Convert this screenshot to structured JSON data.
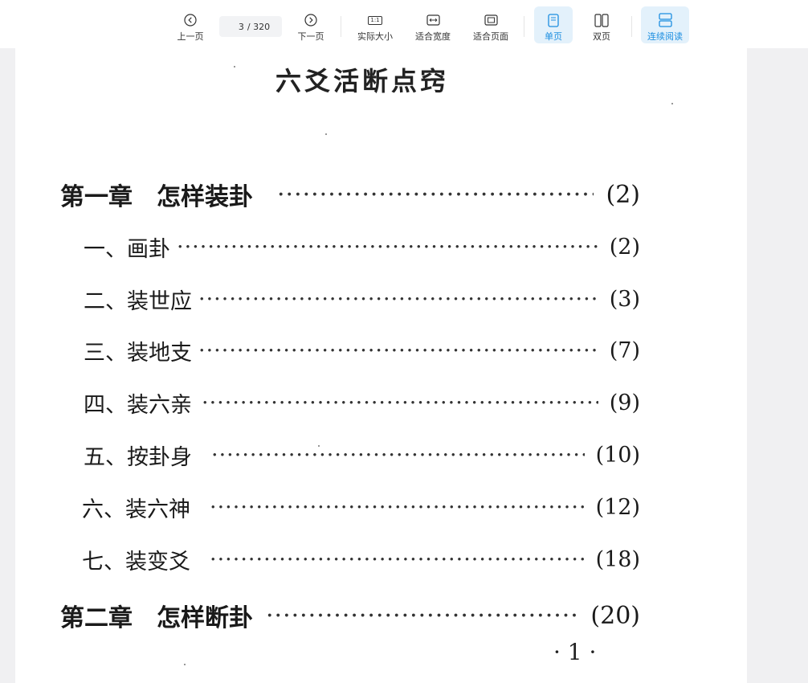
{
  "toolbar": {
    "prev_label": "上一页",
    "next_label": "下一页",
    "current_page": "3",
    "total_pages": "/ 320",
    "actual_size_label": "实际大小",
    "actual_size_glyph": "1:1",
    "fit_width_label": "适合宽度",
    "fit_page_label": "适合页面",
    "single_page_label": "单页",
    "double_page_label": "双页",
    "continuous_label": "连续阅读",
    "accent_color": "#1c8ee0",
    "active_bg": "#e3f1fb"
  },
  "document": {
    "title": "六爻活断点窍",
    "toc": [
      {
        "level": "chapter",
        "text": "第一章　怎样装卦",
        "page": "(2)"
      },
      {
        "level": "section",
        "text": "一、画卦",
        "page": "(2)"
      },
      {
        "level": "section",
        "text": "二、装世应",
        "page": "(3)"
      },
      {
        "level": "section",
        "text": "三、装地支",
        "page": "(7)"
      },
      {
        "level": "section",
        "text": "四、装六亲",
        "page": "(9)"
      },
      {
        "level": "section",
        "text": "五、按卦身",
        "page": "(10)"
      },
      {
        "level": "section",
        "text": "六、装六神",
        "page": "(12)"
      },
      {
        "level": "section",
        "text": "七、装变爻",
        "page": "(18)"
      },
      {
        "level": "chapter",
        "text": "第二章　怎样断卦",
        "page": "(20)"
      }
    ],
    "page_number": "· 1 ·"
  }
}
